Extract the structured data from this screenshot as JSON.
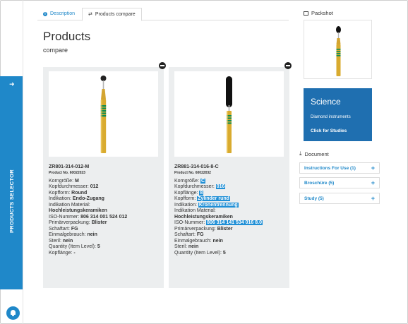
{
  "tabs": [
    {
      "label": "Description"
    },
    {
      "label": "Products compare"
    }
  ],
  "header": {
    "title": "Products",
    "subtitle": "compare"
  },
  "sidebar": {
    "label": "PRODUCTS SELECTOR"
  },
  "products": [
    {
      "code": "ZR801-314-012-M",
      "product_no": "Product No. 60022023",
      "rows": [
        {
          "label": "Korngröße: ",
          "value": "M"
        },
        {
          "label": "Kopfdurchmesser: ",
          "value": "012"
        },
        {
          "label": "Kopfform: ",
          "value": "Round"
        },
        {
          "label": "Indikation: ",
          "value": "Endo-Zugang"
        },
        {
          "label": "Indikation Material:",
          "value": ""
        },
        {
          "label": "",
          "value": "Hochleistungskeramiken"
        },
        {
          "label": "ISO-Nummer: ",
          "value": "806 314 001 524 012"
        },
        {
          "label": "Primärverpackung: ",
          "value": "Blister"
        },
        {
          "label": "Schaftart: ",
          "value": "FG"
        },
        {
          "label": "Einmalgebrauch: ",
          "value": "nein"
        },
        {
          "label": "Steril: ",
          "value": "nein"
        },
        {
          "label": "Quantity (Item Level): ",
          "value": "5"
        },
        {
          "label": "Kopflänge: ",
          "value": "-"
        }
      ]
    },
    {
      "code": "ZR881-314-016-8-C",
      "product_no": "Product No. 60022032",
      "rows": [
        {
          "label": "Korngröße: ",
          "value": "C"
        },
        {
          "label": "Kopfdurchmesser: ",
          "value": "016"
        },
        {
          "label": "Kopflänge: ",
          "value": "8"
        },
        {
          "label": "Kopfform: ",
          "value": "Zylinder rund"
        },
        {
          "label": "Indikation: ",
          "value": "Kronentrennung"
        },
        {
          "label": "Indikation Material:",
          "value": ""
        },
        {
          "label": "",
          "value": "Hochleistungskeramiken"
        },
        {
          "label": "ISO-Nummer: ",
          "value": "806 314 141 534 016 8.0"
        },
        {
          "label": "Primärverpackung: ",
          "value": "Blister"
        },
        {
          "label": "Schaftart: ",
          "value": "FG"
        },
        {
          "label": "Einmalgebrauch: ",
          "value": "nein"
        },
        {
          "label": "Steril: ",
          "value": "nein"
        },
        {
          "label": "Quantity (Item Level): ",
          "value": "5"
        }
      ]
    }
  ],
  "packshot": {
    "heading": "Packshot"
  },
  "science": {
    "title": "Science",
    "subtitle": "Diamond instruments",
    "link": "Click for Studies"
  },
  "documents": {
    "heading": "Document",
    "items": [
      {
        "label": "Instructions For Use (1)"
      },
      {
        "label": "Broschüre (5)"
      },
      {
        "label": "Study (5)"
      }
    ]
  },
  "colors": {
    "accent": "#1f88c9",
    "science_bg": "#1f6fb0",
    "highlight": "#1f8fd6",
    "shank_gold": "#d4a531"
  },
  "icons": [
    "info-icon",
    "compare-icon",
    "arrow-right-icon",
    "remove-icon",
    "image-icon",
    "download-icon",
    "plus-icon",
    "bell-icon"
  ]
}
